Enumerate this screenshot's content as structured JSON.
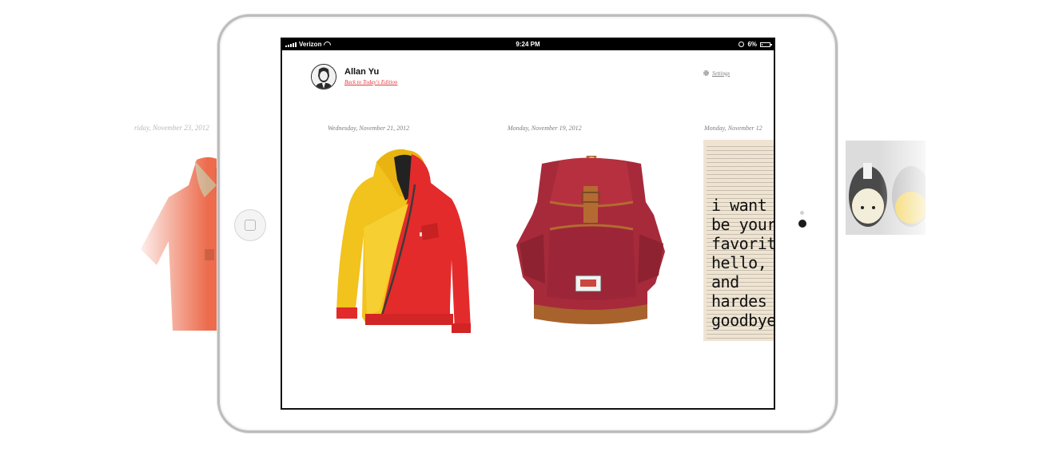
{
  "status_bar": {
    "carrier": "Verizon",
    "time": "9:24 PM",
    "battery": "6%"
  },
  "profile": {
    "name": "Allan Yu",
    "back_link": "Back to Today's Edition"
  },
  "settings": {
    "label": "Settings"
  },
  "editions": [
    {
      "date": "Wednesday, November 21, 2012",
      "item": "yellow-red-hoodie"
    },
    {
      "date": "Monday, November 19, 2012",
      "item": "red-backpack"
    },
    {
      "date": "Monday, November 12",
      "item": "book-quote-print"
    }
  ],
  "background": {
    "left_date": "riday, November 23, 2012"
  },
  "book_quote": "i want\nbe your\nfavorit\nhello,\nand\nhardes\ngoodbye.",
  "colors": {
    "link": "#e0393e",
    "date_text": "#7d7d7d",
    "frame": "#bcbcbc"
  }
}
